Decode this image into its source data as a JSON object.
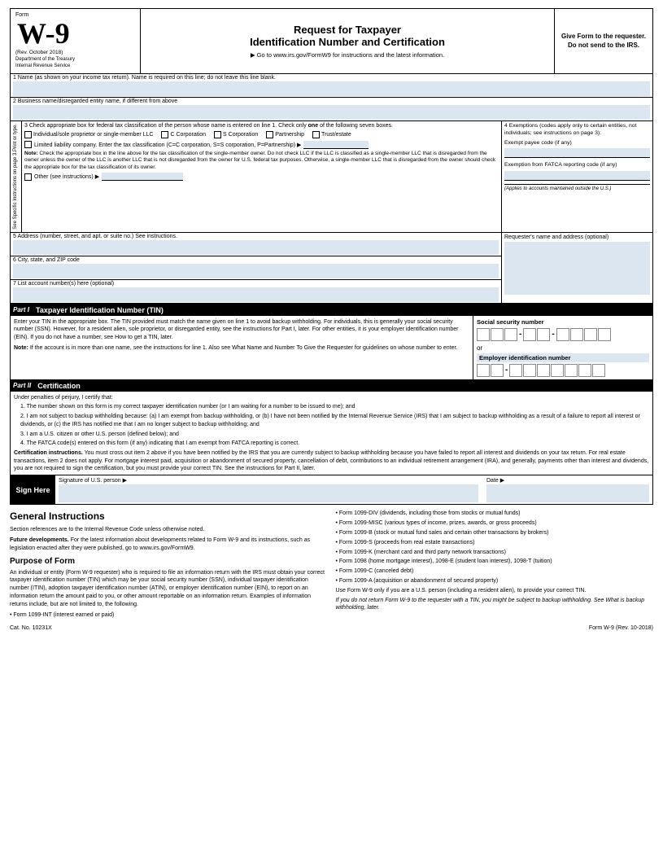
{
  "header": {
    "form_label": "Form",
    "form_name": "W-9",
    "rev": "(Rev. October 2018)",
    "dept1": "Department of the Treasury",
    "dept2": "Internal Revenue Service",
    "title1": "Request for Taxpayer",
    "title2": "Identification Number and Certification",
    "goto": "▶ Go to www.irs.gov/FormW9 for instructions and the latest information.",
    "give_form": "Give Form to the requester. Do not send to the IRS."
  },
  "lines": {
    "line1_label": "1  Name (as shown on your income tax return). Name is required on this line; do not leave this line blank.",
    "line2_label": "2  Business name/disregarded entity name, if different from above",
    "line3_label": "3  Check appropriate box for federal tax classification of the person whose name is entered on line 1. Check only",
    "line3_label_one": "one",
    "line3_label2": "of the following seven boxes.",
    "checkbox_individual": "Individual/sole proprietor or single-member LLC",
    "checkbox_c_corp": "C Corporation",
    "checkbox_s_corp": "S Corporation",
    "checkbox_partnership": "Partnership",
    "checkbox_trust": "Trust/estate",
    "llc_label": "Limited liability company. Enter the tax classification (C=C corporation, S=S corporation, P=Partnership) ▶",
    "note_label": "Note:",
    "note_text": "Check the appropriate box in the line above for the tax classification of the single-member owner. Do not check LLC if the LLC is classified as a single-member LLC that is disregarded from the owner unless the owner of the LLC is another LLC that is not disregarded from the owner for U.S. federal tax purposes. Otherwise, a single-member LLC that is disregarded from the owner should check the appropriate box for the tax classification of its owner.",
    "other_label": "Other (see instructions) ▶",
    "line4_label": "4  Exemptions (codes apply only to certain entities, not individuals; see instructions on page 3):",
    "exempt_payee_label": "Exempt payee code (if any)",
    "fatca_label": "Exemption from FATCA reporting code (if any)",
    "fatca_note": "(Applies to accounts maintained outside the U.S.)",
    "line5_label": "5  Address (number, street, and apt. or suite no.) See instructions.",
    "line5_right": "Requester's name and address (optional)",
    "line6_label": "6  City, state, and ZIP code",
    "line7_label": "7  List account number(s) here (optional)"
  },
  "sidebar": {
    "text1": "Print or type.",
    "text2": "See Specific Instructions on page 3."
  },
  "part1": {
    "label": "Part I",
    "title": "Taxpayer Identification Number (TIN)",
    "description": "Enter your TIN in the appropriate box. The TIN provided must match the name given on line 1 to avoid backup withholding. For individuals, this is generally your social security number (SSN). However, for a resident alien, sole proprietor, or disregarded entity, see the instructions for Part I, later. For other entities, it is your employer identification number (EIN). If you do not have a number, see How to get a TIN, later.",
    "note": "Note:",
    "note_text": "If the account is in more than one name, see the instructions for line 1. Also see What Name and Number To Give the Requester for guidelines on whose number to enter.",
    "ssn_label": "Social security number",
    "or_text": "or",
    "ein_label": "Employer identification number"
  },
  "part2": {
    "label": "Part II",
    "title": "Certification",
    "intro": "Under penalties of perjury, I certify that:",
    "cert1": "1. The number shown on this form is my correct taxpayer identification number (or I am waiting for a number to be issued to me); and",
    "cert2": "2. I am not subject to backup withholding because: (a) I am exempt from backup withholding, or (b) I have not been notified by the Internal Revenue Service (IRS) that I am subject to backup withholding as a result of a failure to report all interest or dividends, or (c) the IRS has notified me that I am no longer subject to backup withholding; and",
    "cert3": "3. I am a U.S. citizen or other U.S. person (defined below); and",
    "cert4": "4. The FATCA code(s) entered on this form (if any) indicating that I am exempt from FATCA reporting is correct.",
    "cert_instructions_label": "Certification instructions.",
    "cert_instructions": "You must cross out item 2 above if you have been notified by the IRS that you are currently subject to backup withholding because you have failed to report all interest and dividends on your tax return. For real estate transactions, item 2 does not apply. For mortgage interest paid, acquisition or abandonment of secured property, cancellation of debt, contributions to an individual retirement arrangement (IRA), and generally, payments other than interest and dividends, you are not required to sign the certification, but you must provide your correct TIN. See the instructions for Part II, later."
  },
  "sign": {
    "sign_here": "Sign Here",
    "signature_label": "Signature of U.S. person ▶",
    "date_label": "Date ▶"
  },
  "general": {
    "title": "General Instructions",
    "intro": "Section references are to the Internal Revenue Code unless otherwise noted.",
    "future_label": "Future developments.",
    "future_text": "For the latest information about developments related to Form W-9 and its instructions, such as legislation enacted after they were published, go to www.irs.gov/FormW9.",
    "purpose_title": "Purpose of Form",
    "purpose_text": "An individual or entity (Form W-9 requester) who is required to file an information return with the IRS must obtain your correct taxpayer identification number (TIN) which may be your social security number (SSN), individual taxpayer identification number (ITIN), adoption taxpayer identification number (ATIN), or employer identification number (EIN), to report on an information return the amount paid to you, or other amount reportable on an information return. Examples of information returns include, but are not limited to, the following.",
    "bullet1": "• Form 1099-INT (interest earned or paid)",
    "right_bullets": [
      "• Form 1099-DIV (dividends, including those from stocks or mutual funds)",
      "• Form 1099-MISC (various types of income, prizes, awards, or gross proceeds)",
      "• Form 1099-B (stock or mutual fund sales and certain other transactions by brokers)",
      "• Form 1099-S (proceeds from real estate transactions)",
      "• Form 1099-K (merchant card and third party network transactions)",
      "• Form 1098 (home mortgage interest), 1098-E (student loan interest), 1098-T (tuition)",
      "• Form 1099-C (canceled debt)",
      "• Form 1099-A (acquisition or abandonment of secured property)",
      "Use Form W-9 only if you are a U.S. person (including a resident alien), to provide your correct TIN.",
      "If you do not return Form W-9 to the requester with a TIN, you might be subject to backup withholding. See What is backup withholding, later."
    ]
  },
  "footer": {
    "cat": "Cat. No. 10231X",
    "form": "Form W-9 (Rev. 10-2018)"
  }
}
